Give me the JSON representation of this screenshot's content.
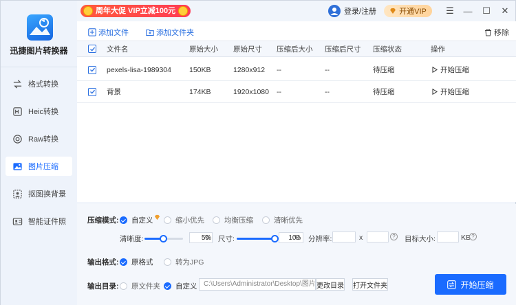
{
  "app": {
    "name": "迅捷图片转换器"
  },
  "promo": {
    "text": "周年大促 VIP立减100元"
  },
  "header": {
    "login_label": "登录/注册",
    "vip_label": "开通VIP"
  },
  "window": {
    "menu": "☰",
    "minimize": "—",
    "maximize": "☐",
    "close": "✕"
  },
  "sidebar": {
    "items": [
      {
        "label": "格式转换",
        "icon": "swap-icon"
      },
      {
        "label": "Heic转换",
        "icon": "heic-icon"
      },
      {
        "label": "Raw转换",
        "icon": "camera-icon"
      },
      {
        "label": "图片压缩",
        "icon": "image-compress-icon",
        "active": true
      },
      {
        "label": "抠图换背景",
        "icon": "cutout-icon"
      },
      {
        "label": "智能证件照",
        "icon": "id-photo-icon"
      }
    ]
  },
  "toolbar": {
    "add_file": "添加文件",
    "add_folder": "添加文件夹",
    "remove": "移除"
  },
  "table": {
    "headers": [
      "文件名",
      "原始大小",
      "原始尺寸",
      "压缩后大小",
      "压缩后尺寸",
      "压缩状态",
      "操作"
    ],
    "rows": [
      {
        "name": "pexels-lisa-1989304",
        "size": "150KB",
        "dims": "1280x912",
        "new_size": "--",
        "new_dims": "--",
        "status": "待压缩",
        "action": "开始压缩"
      },
      {
        "name": "背景",
        "size": "174KB",
        "dims": "1920x1080",
        "new_size": "--",
        "new_dims": "--",
        "status": "待压缩",
        "action": "开始压缩"
      }
    ]
  },
  "settings": {
    "mode_label": "压缩模式:",
    "modes": [
      {
        "label": "自定义",
        "selected": true
      },
      {
        "label": "缩小优先",
        "selected": false
      },
      {
        "label": "均衡压缩",
        "selected": false
      },
      {
        "label": "清晰优先",
        "selected": false
      }
    ],
    "clarity_label": "清晰度:",
    "clarity_value": "50",
    "clarity_level": 0.5,
    "percent": "%",
    "size_label": "尺寸:",
    "size_value": "100",
    "size_level": 1.0,
    "resolution_label": "分辨率:",
    "x_label": "x",
    "target_label": "目标大小:",
    "kb_unit": "KB",
    "help": "?",
    "format_label": "输出格式:",
    "formats": [
      {
        "label": "原格式",
        "selected": true
      },
      {
        "label": "转为JPG",
        "selected": false
      }
    ],
    "dir_label": "输出目录:",
    "dirs": [
      {
        "label": "原文件夹",
        "selected": false
      },
      {
        "label": "自定义",
        "selected": true
      }
    ],
    "path": "C:\\Users\\Administrator\\Desktop\\图片",
    "change_dir": "更改目录",
    "open_folder": "打开文件夹",
    "start": "开始压缩"
  },
  "colors": {
    "accent": "#1a6bff",
    "promo": "#ff4a48",
    "vip": "#ffd9a3"
  }
}
